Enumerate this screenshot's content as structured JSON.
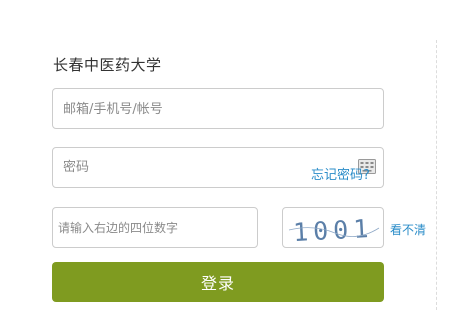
{
  "header": {
    "school_name": "长春中医药大学"
  },
  "form": {
    "account_placeholder": "邮箱/手机号/帐号",
    "account_value": "",
    "password_placeholder": "密码",
    "password_value": "",
    "forgot_password_label": "忘记密码?",
    "captcha_placeholder": "请输入右边的四位数字",
    "captcha_value": "",
    "captcha_image_text": "1001",
    "refresh_captcha_label": "看不清",
    "login_button_label": "登录"
  },
  "icons": {
    "keyboard": "keyboard-icon"
  },
  "colors": {
    "primary_button": "#7f9b20",
    "link": "#2a8cc8",
    "captcha_ink": "#5b7fa8"
  }
}
